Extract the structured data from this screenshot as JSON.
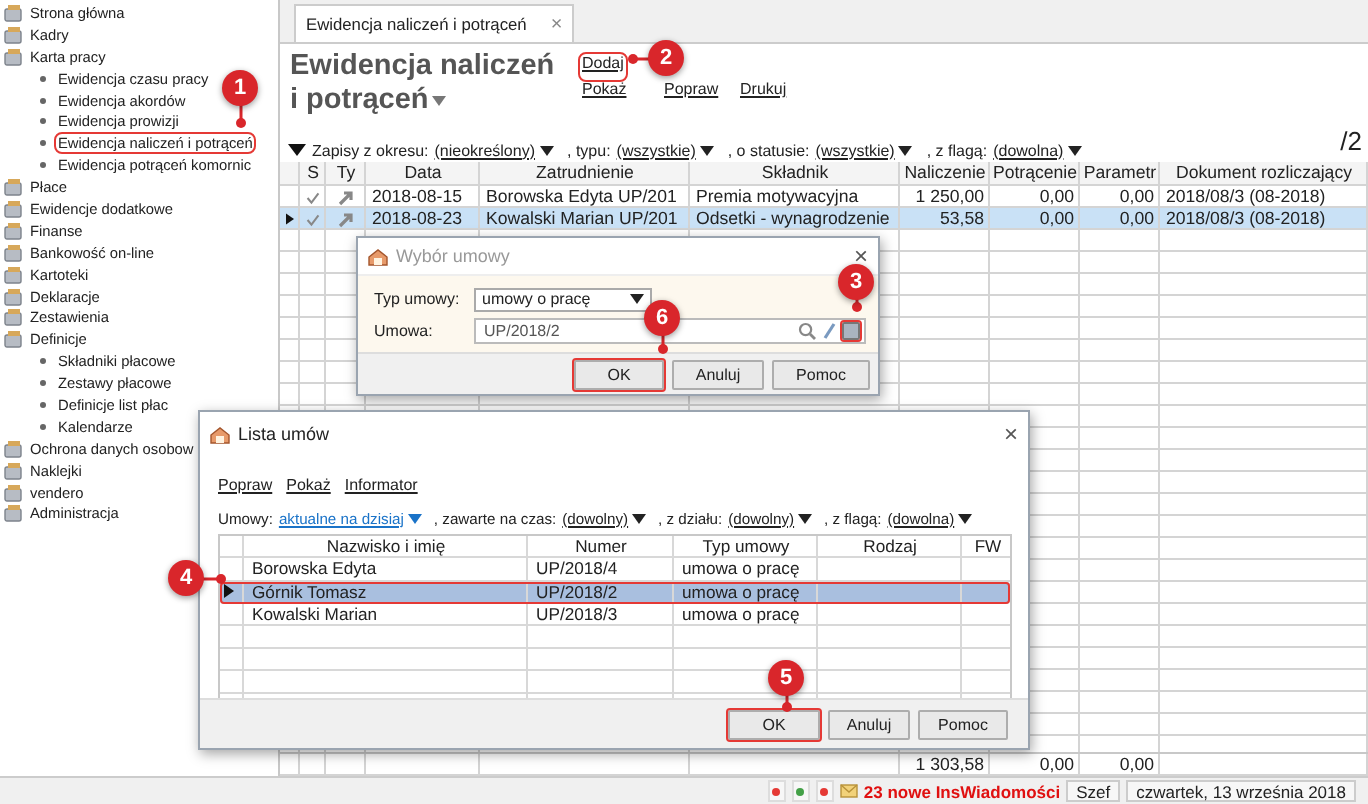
{
  "sidebar": {
    "items": [
      {
        "label": "Strona główna",
        "highlighted": false
      },
      {
        "label": "Kadry",
        "highlighted": false
      },
      {
        "label": "Karta pracy",
        "highlighted": false,
        "children": [
          {
            "label": "Ewidencja czasu pracy",
            "highlighted": false
          },
          {
            "label": "Ewidencja akordów",
            "highlighted": false
          },
          {
            "label": "Ewidencja prowizji",
            "highlighted": false
          },
          {
            "label": "Ewidencja naliczeń i potrąceń",
            "highlighted": true
          },
          {
            "label": "Ewidencja potrąceń komornic",
            "highlighted": false
          }
        ]
      },
      {
        "label": "Płace",
        "highlighted": false
      },
      {
        "label": "Ewidencje dodatkowe",
        "highlighted": false
      },
      {
        "label": "Finanse",
        "highlighted": false
      },
      {
        "label": "Bankowość on-line",
        "highlighted": false
      },
      {
        "label": "Kartoteki",
        "highlighted": false
      },
      {
        "label": "Deklaracje",
        "highlighted": false
      },
      {
        "label": "Zestawienia",
        "highlighted": false
      },
      {
        "label": "Definicje",
        "highlighted": false,
        "children": [
          {
            "label": "Składniki płacowe",
            "highlighted": false
          },
          {
            "label": "Zestawy płacowe",
            "highlighted": false
          },
          {
            "label": "Definicje list płac",
            "highlighted": false
          },
          {
            "label": "Kalendarze",
            "highlighted": false
          }
        ]
      },
      {
        "label": "Ochrona danych osobow",
        "highlighted": false
      },
      {
        "label": "Naklejki",
        "highlighted": false
      },
      {
        "label": "vendero",
        "highlighted": false
      },
      {
        "label": "Administracja",
        "highlighted": false
      }
    ]
  },
  "tabs": [
    {
      "label": "Ewidencja naliczeń i potrąceń",
      "selected": true,
      "close": "×"
    }
  ],
  "header": {
    "title_lines": [
      "Ewidencja naliczeń",
      "i potrąceń"
    ],
    "actions": [
      {
        "label": "Dodaj",
        "highlighted": true
      },
      {
        "label": "Pokaż",
        "highlighted": false
      },
      {
        "label": "Popraw",
        "highlighted": false
      },
      {
        "label": "Drukuj",
        "highlighted": false
      }
    ]
  },
  "filters": [
    {
      "label": "Zapisy z okresu:",
      "value": "(nieokreślony)"
    },
    {
      "label": ", typu:",
      "value": "(wszystkie)"
    },
    {
      "label": ", o statusie:",
      "value": "(wszystkie)"
    },
    {
      "label": ", z flagą:",
      "value": "(dowolna)"
    }
  ],
  "page_count": "/2",
  "table": {
    "icon_columns": [
      "S",
      "Ty"
    ],
    "columns": [
      "Data",
      "Zatrudnienie",
      "Składnik",
      "Naliczenie",
      "Potrącenie",
      "Parametr",
      "Dokument rozliczający"
    ],
    "rows": [
      {
        "selected": false,
        "checked": true,
        "cells": [
          "2018-08-15",
          "Borowska Edyta UP/201",
          "Premia motywacyjna",
          "1 250,00",
          "0,00",
          "0,00",
          "2018/08/3 (08-2018)"
        ]
      },
      {
        "selected": true,
        "checked": true,
        "cells": [
          "2018-08-23",
          "Kowalski Marian UP/201",
          "Odsetki - wynagrodzenie",
          "53,58",
          "0,00",
          "0,00",
          "2018/08/3 (08-2018)"
        ]
      }
    ],
    "totals": [
      "1 303,58",
      "0,00",
      "0,00"
    ]
  },
  "status_bar": {
    "indicators": [
      {
        "color": "#e53935"
      },
      {
        "color": "#43a047"
      },
      {
        "color": "#e53935"
      }
    ],
    "messages": "23 nowe InsWiadomości",
    "user": "Szef",
    "date": "czwartek, 13 września 2018"
  },
  "contract_dialog": {
    "title": "Wybór umowy",
    "close": "×",
    "fields": [
      {
        "kind": "select",
        "label": "Typ umowy:",
        "value": "umowy o pracę"
      },
      {
        "kind": "lookup",
        "label": "Umowa:",
        "value": "UP/2018/2",
        "button_highlighted": true
      }
    ],
    "buttons": [
      {
        "label": "OK",
        "highlighted": true
      },
      {
        "label": "Anuluj",
        "highlighted": false
      },
      {
        "label": "Pomoc",
        "highlighted": false
      }
    ]
  },
  "list_dialog": {
    "title": "Lista umów",
    "close": "×",
    "actions": [
      "Popraw",
      "Pokaż",
      "Informator"
    ],
    "filters": [
      {
        "label": "Umowy:",
        "value": "aktualne na dzisiaj"
      },
      {
        "label": ", zawarte na czas:",
        "value": "(dowolny)"
      },
      {
        "label": ", z działu:",
        "value": "(dowolny)"
      },
      {
        "label": ", z flagą:",
        "value": "(dowolna)"
      }
    ],
    "columns": [
      "Nazwisko i imię",
      "Numer",
      "Typ umowy",
      "Rodzaj",
      "FW"
    ],
    "rows": [
      {
        "selected": false,
        "highlighted": false,
        "cells": [
          "Borowska Edyta",
          "UP/2018/4",
          "umowa o pracę"
        ]
      },
      {
        "selected": true,
        "highlighted": true,
        "cells": [
          "Górnik Tomasz",
          "UP/2018/2",
          "umowa o pracę"
        ]
      },
      {
        "selected": false,
        "highlighted": false,
        "cells": [
          "Kowalski Marian",
          "UP/2018/3",
          "umowa o pracę"
        ]
      }
    ],
    "buttons": [
      {
        "label": "OK",
        "highlighted": true
      },
      {
        "label": "Anuluj",
        "highlighted": false
      },
      {
        "label": "Pomoc",
        "highlighted": false
      }
    ]
  },
  "callouts": [
    {
      "label": "1"
    },
    {
      "label": "2"
    },
    {
      "label": "3"
    },
    {
      "label": "4"
    },
    {
      "label": "5"
    },
    {
      "label": "6"
    }
  ]
}
